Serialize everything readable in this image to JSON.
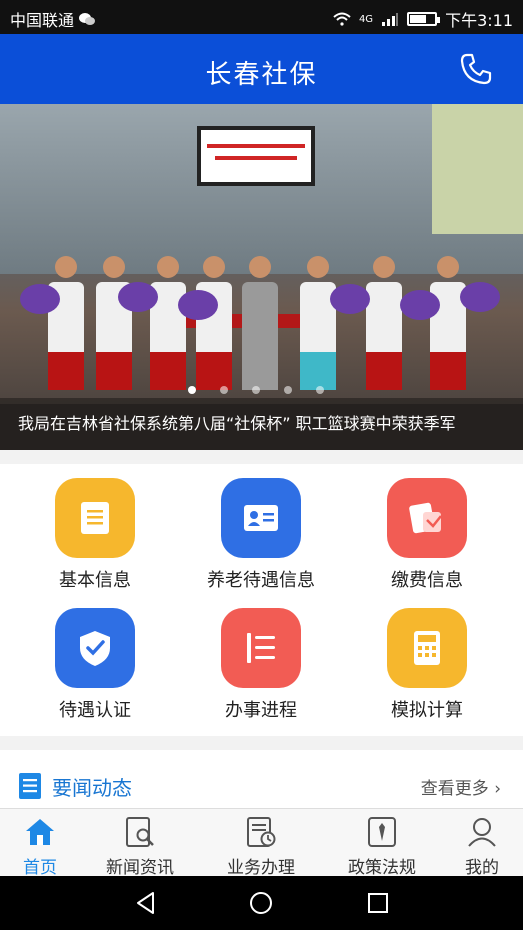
{
  "status": {
    "carrier": "中国联通",
    "network": "4G",
    "time": "下午3:11"
  },
  "header": {
    "title": "长春社保"
  },
  "banner": {
    "caption": "我局在吉林省社保系统第八届“社保杯” 职工篮球赛中荣获季军",
    "slide_count": 5,
    "active_slide": 1
  },
  "services": [
    {
      "label": "基本信息",
      "color": "#f6b72d",
      "icon": "document-icon"
    },
    {
      "label": "养老待遇信息",
      "color": "#2f6fe4",
      "icon": "id-card-icon"
    },
    {
      "label": "缴费信息",
      "color": "#f25c54",
      "icon": "card-payment-icon"
    },
    {
      "label": "待遇认证",
      "color": "#2f6fe4",
      "icon": "shield-check-icon"
    },
    {
      "label": "办事进程",
      "color": "#f25c54",
      "icon": "progress-list-icon"
    },
    {
      "label": "模拟计算",
      "color": "#f6b72d",
      "icon": "calculator-icon"
    }
  ],
  "news": {
    "title": "要闻动态",
    "more": "查看更多"
  },
  "tabs": [
    {
      "label": "首页",
      "icon": "home-icon",
      "active": true
    },
    {
      "label": "新闻资讯",
      "icon": "news-search-icon",
      "active": false
    },
    {
      "label": "业务办理",
      "icon": "business-clock-icon",
      "active": false
    },
    {
      "label": "政策法规",
      "icon": "policy-icon",
      "active": false
    },
    {
      "label": "我的",
      "icon": "profile-icon",
      "active": false
    }
  ]
}
